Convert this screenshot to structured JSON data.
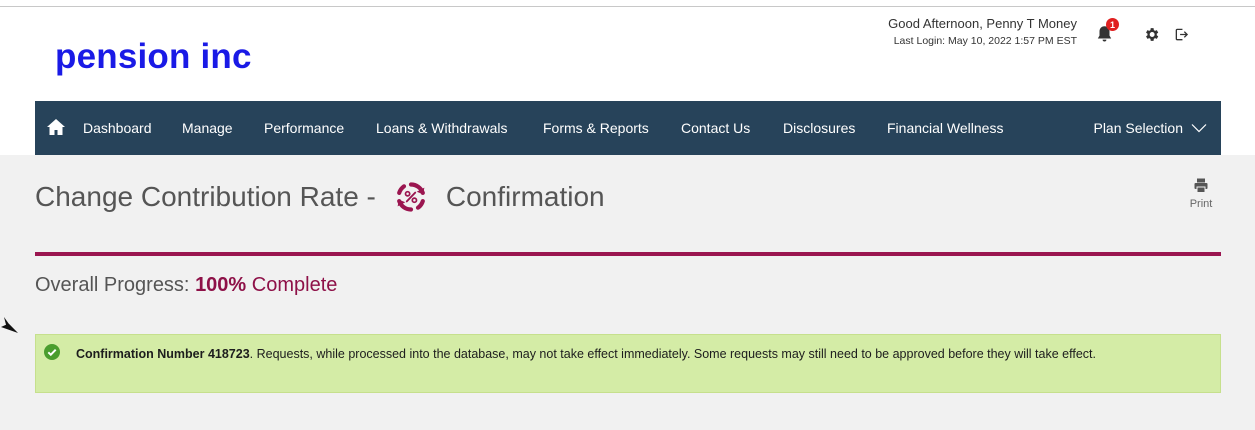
{
  "header": {
    "logo": "pension inc",
    "greeting": "Good Afternoon,  Penny T Money",
    "last_login": "Last Login: May 10, 2022 1:57 PM EST",
    "notification_count": "1",
    "icons": {
      "bell": "bell-icon",
      "gear": "gear-icon",
      "logout": "logout-icon"
    }
  },
  "nav": {
    "home_icon": "home-icon",
    "items": [
      {
        "label": "Dashboard"
      },
      {
        "label": "Manage"
      },
      {
        "label": "Performance"
      },
      {
        "label": "Loans & Withdrawals"
      },
      {
        "label": "Forms & Reports"
      },
      {
        "label": "Contact Us"
      },
      {
        "label": "Disclosures"
      },
      {
        "label": "Financial Wellness"
      }
    ],
    "plan_selection": "Plan Selection"
  },
  "page": {
    "title_left": "Change Contribution Rate -",
    "title_icon": "percent-refresh-icon",
    "title_right": "Confirmation",
    "print_label": "Print",
    "progress_label": "Overall Progress:",
    "progress_value": "100%",
    "progress_status": "Complete"
  },
  "alert": {
    "icon": "check-circle-icon",
    "bold_text": "Confirmation Number 418723",
    "message": ". Requests, while processed into the database, may not take effect immediately. Some requests may still need to be approved before they will take effect."
  },
  "colors": {
    "brand_blue": "#1a1ae6",
    "nav_bg": "#27435a",
    "accent": "#9b1650",
    "alert_bg": "#d4eca6",
    "badge": "#e02020"
  }
}
